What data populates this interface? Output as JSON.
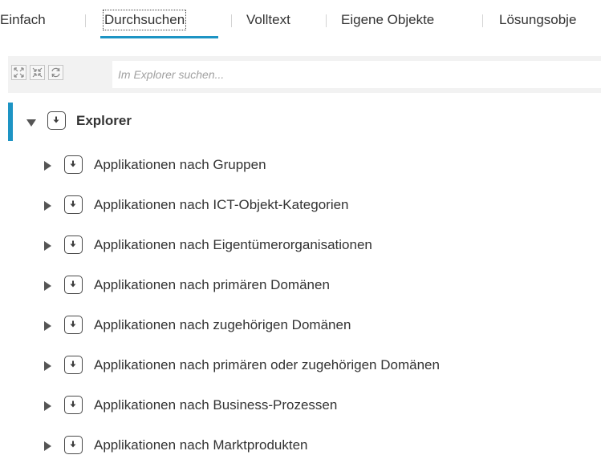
{
  "tabs": [
    {
      "label": "Einfach"
    },
    {
      "label": "Durchsuchen",
      "active": true
    },
    {
      "label": "Volltext"
    },
    {
      "label": "Eigene Objekte"
    },
    {
      "label": "Lösungsobje"
    }
  ],
  "toolbar": {
    "buttons": [
      "expand-all-icon",
      "collapse-all-icon",
      "refresh-icon"
    ],
    "search_placeholder": "Im Explorer suchen..."
  },
  "tree": {
    "root_label": "Explorer",
    "items": [
      {
        "label": "Applikationen nach Gruppen"
      },
      {
        "label": "Applikationen nach ICT-Objekt-Kategorien"
      },
      {
        "label": "Applikationen nach Eigentümerorganisationen"
      },
      {
        "label": "Applikationen nach primären Domänen"
      },
      {
        "label": "Applikationen nach zugehörigen Domänen"
      },
      {
        "label": "Applikationen nach primären oder zugehörigen Domänen"
      },
      {
        "label": "Applikationen nach Business-Prozessen"
      },
      {
        "label": "Applikationen nach Marktprodukten"
      }
    ]
  },
  "colors": {
    "accent": "#1d94c4",
    "toolbar_bg": "#f2f2f2"
  }
}
